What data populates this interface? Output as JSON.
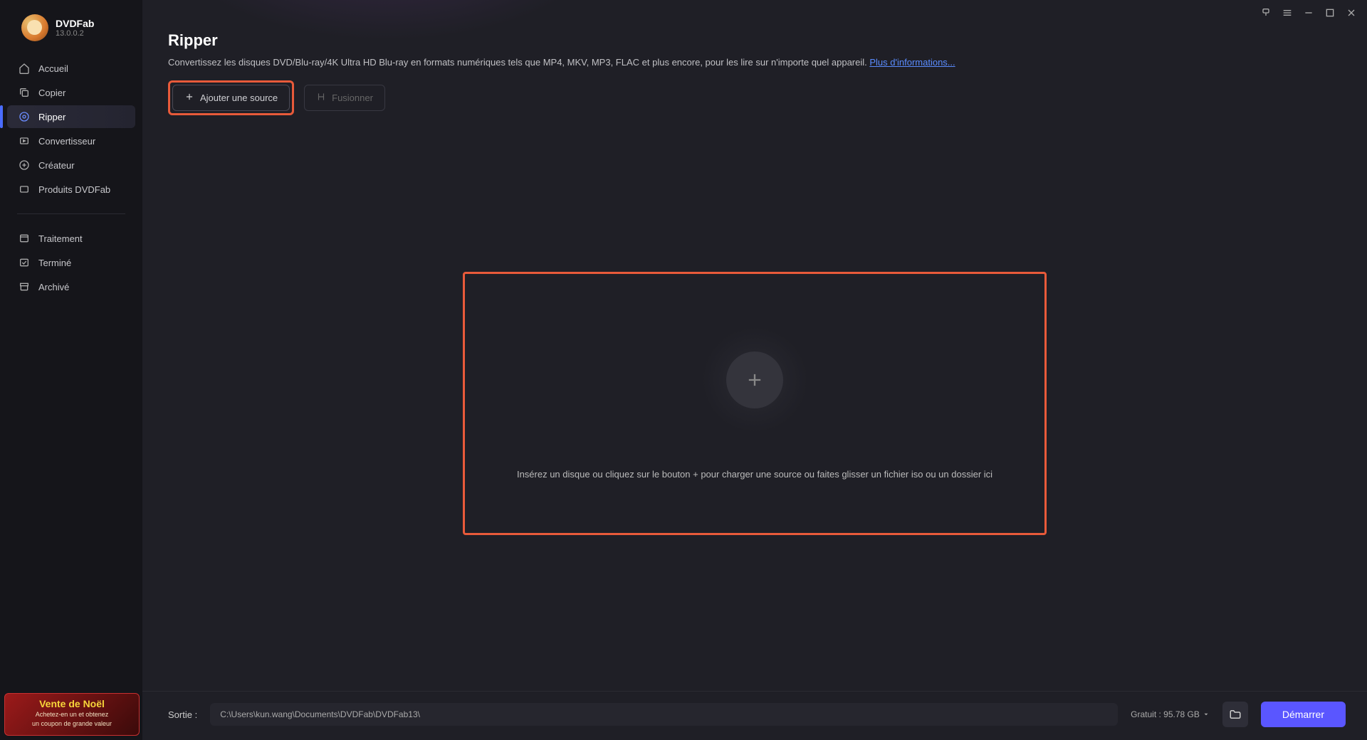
{
  "app": {
    "name": "DVDFab",
    "version": "13.0.0.2"
  },
  "sidebar": {
    "primary": [
      {
        "icon": "home",
        "label": "Accueil"
      },
      {
        "icon": "copy",
        "label": "Copier"
      },
      {
        "icon": "rip",
        "label": "Ripper"
      },
      {
        "icon": "convert",
        "label": "Convertisseur"
      },
      {
        "icon": "create",
        "label": "Créateur"
      },
      {
        "icon": "products",
        "label": "Produits DVDFab"
      }
    ],
    "secondary": [
      {
        "icon": "process",
        "label": "Traitement"
      },
      {
        "icon": "done",
        "label": "Terminé"
      },
      {
        "icon": "archive",
        "label": "Archivé"
      }
    ]
  },
  "promo": {
    "title": "Vente de Noël",
    "line1": "Achetez-en un et obtenez",
    "line2": "un coupon de grande valeur"
  },
  "page": {
    "title": "Ripper",
    "description": "Convertissez les disques DVD/Blu-ray/4K Ultra HD Blu-ray en formats numériques tels que MP4, MKV, MP3, FLAC et plus encore, pour les lire sur n'importe quel appareil.",
    "more_info": "Plus d'informations...",
    "add_source": "Ajouter une source",
    "merge": "Fusionner",
    "drop_hint": "Insérez un disque ou cliquez sur le bouton +  pour charger une source ou faites glisser un fichier iso ou un dossier ici"
  },
  "footer": {
    "output_label": "Sortie :",
    "output_path": "C:\\Users\\kun.wang\\Documents\\DVDFab\\DVDFab13\\",
    "free_label": "Gratuit : 95.78 GB",
    "start": "Démarrer"
  }
}
